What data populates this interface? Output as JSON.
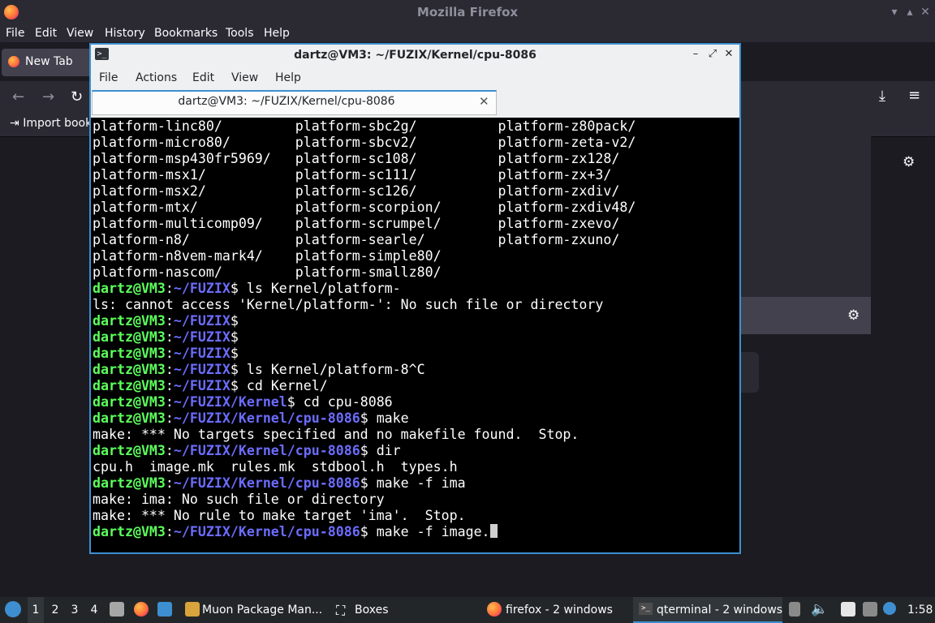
{
  "firefox": {
    "window_title": "Mozilla Firefox",
    "menu": [
      "File",
      "Edit",
      "View",
      "History",
      "Bookmarks",
      "Tools",
      "Help"
    ],
    "tab_label": "New Tab",
    "bookmark_label": "Import book"
  },
  "terminal": {
    "window_title": "dartz@VM3: ~/FUZIX/Kernel/cpu-8086",
    "menu": [
      "File",
      "Actions",
      "Edit",
      "View",
      "Help"
    ],
    "tab_label": "dartz@VM3: ~/FUZIX/Kernel/cpu-8086",
    "lines": [
      {
        "text": "platform-linc80/         platform-sbc2g/          platform-z80pack/"
      },
      {
        "text": "platform-micro80/        platform-sbcv2/          platform-zeta-v2/"
      },
      {
        "text": "platform-msp430fr5969/   platform-sc108/          platform-zx128/"
      },
      {
        "text": "platform-msx1/           platform-sc111/          platform-zx+3/"
      },
      {
        "text": "platform-msx2/           platform-sc126/          platform-zxdiv/"
      },
      {
        "text": "platform-mtx/            platform-scorpion/       platform-zxdiv48/"
      },
      {
        "text": "platform-multicomp09/    platform-scrumpel/       platform-zxevo/"
      },
      {
        "text": "platform-n8/             platform-searle/         platform-zxuno/"
      },
      {
        "text": "platform-n8vem-mark4/    platform-simple80/"
      },
      {
        "text": "platform-nascom/         platform-smallz80/"
      },
      {
        "user": "dartz@VM3",
        "path": "~/FUZIX",
        "cmd": "ls Kernel/platform-"
      },
      {
        "text": "ls: cannot access 'Kernel/platform-': No such file or directory"
      },
      {
        "user": "dartz@VM3",
        "path": "~/FUZIX",
        "cmd": ""
      },
      {
        "user": "dartz@VM3",
        "path": "~/FUZIX",
        "cmd": ""
      },
      {
        "user": "dartz@VM3",
        "path": "~/FUZIX",
        "cmd": ""
      },
      {
        "user": "dartz@VM3",
        "path": "~/FUZIX",
        "cmd": "ls Kernel/platform-8^C"
      },
      {
        "user": "dartz@VM3",
        "path": "~/FUZIX",
        "cmd": "cd Kernel/"
      },
      {
        "user": "dartz@VM3",
        "path": "~/FUZIX/Kernel",
        "cmd": "cd cpu-8086"
      },
      {
        "user": "dartz@VM3",
        "path": "~/FUZIX/Kernel/cpu-8086",
        "cmd": "make"
      },
      {
        "text": "make: *** No targets specified and no makefile found.  Stop."
      },
      {
        "user": "dartz@VM3",
        "path": "~/FUZIX/Kernel/cpu-8086",
        "cmd": "dir"
      },
      {
        "text": "cpu.h  image.mk  rules.mk  stdbool.h  types.h"
      },
      {
        "user": "dartz@VM3",
        "path": "~/FUZIX/Kernel/cpu-8086",
        "cmd": "make -f ima"
      },
      {
        "text": "make: ima: No such file or directory"
      },
      {
        "text": "make: *** No rule to make target 'ima'.  Stop."
      },
      {
        "user": "dartz@VM3",
        "path": "~/FUZIX/Kernel/cpu-8086",
        "cmd": "make -f image.",
        "cursor": true
      }
    ]
  },
  "taskbar": {
    "desktops": [
      "1",
      "2",
      "3",
      "4"
    ],
    "tasks": [
      "Muon Package Man...",
      "Boxes",
      "firefox - 2 windows",
      "qterminal - 2 windows"
    ],
    "clock": "1:58"
  },
  "colors": {
    "prompt_user": "#5cff5c",
    "prompt_path": "#6c6cff",
    "accent": "#3d8fd1"
  }
}
